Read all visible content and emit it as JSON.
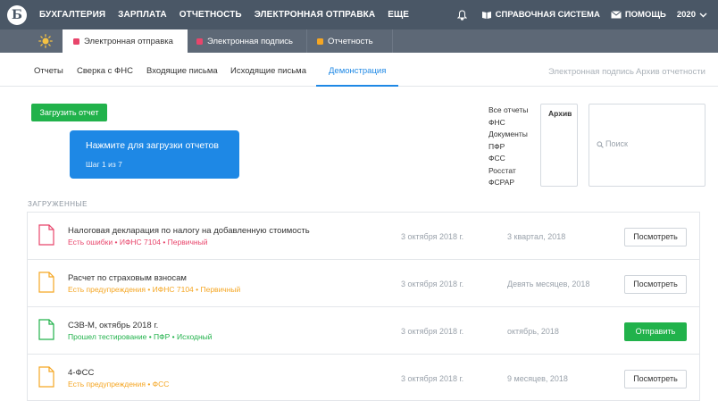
{
  "topbar": {
    "logo": "Б",
    "nav": [
      "БУХГАЛТЕРИЯ",
      "ЗАРПЛАТА",
      "ОТЧЕТНОСТЬ",
      "ЭЛЕКТРОННАЯ ОТПРАВКА",
      "ЕЩЕ"
    ],
    "help_system": "СПРАВОЧНАЯ СИСТЕМА",
    "help": "ПОМОЩЬ",
    "year": "2020"
  },
  "window_tabs": [
    {
      "label": "Электронная отправка",
      "color": "#e8456b"
    },
    {
      "label": "Электронная подпись",
      "color": "#e8456b"
    },
    {
      "label": "Отчетность",
      "color": "#f5a623"
    }
  ],
  "subnav": {
    "tabs": [
      "Отчеты",
      "Сверка с ФНС",
      "Входящие письма",
      "Исходящие письма",
      "Демонстрация"
    ],
    "right": [
      "Электронная подпись",
      "Архив отчетности"
    ]
  },
  "upload_button": "Загрузить отчет",
  "tooltip": {
    "title": "Нажмите для загрузки отчетов",
    "step": "Шаг 1 из 7"
  },
  "filters": [
    "Все отчеты",
    "ФНС",
    "Документы",
    "ПФР",
    "ФСС",
    "Росстат",
    "ФСРАР"
  ],
  "archive": "Архив",
  "search": {
    "placeholder": "Поиск"
  },
  "section_title": "ЗАГРУЖЕННЫЕ",
  "reports": [
    {
      "name": "Налоговая декларация по налогу на добавленную стоимость",
      "status": "Есть ошибки • ИФНС 7104 • Первичный",
      "date": "3 октября 2018 г.",
      "period": "3 квартал, 2018",
      "action": "Посмотреть",
      "color": "#e8456b"
    },
    {
      "name": "Расчет по страховым взносам",
      "status": "Есть предупреждения • ИФНС 7104 • Первичный",
      "date": "3 октября 2018 г.",
      "period": "Девять месяцев, 2018",
      "action": "Посмотреть",
      "color": "#f5a623"
    },
    {
      "name": "СЗВ-М, октябрь 2018 г.",
      "status": "Прошел тестирование • ПФР • Исходный",
      "date": "3 октября 2018 г.",
      "period": "октябрь, 2018",
      "action": "Отправить",
      "color": "#21b24b"
    },
    {
      "name": "4-ФСС",
      "status": "Есть предупреждения • ФСС",
      "date": "3 октября 2018 г.",
      "period": "9 месяцев, 2018",
      "action": "Посмотреть",
      "color": "#f5a623"
    }
  ]
}
